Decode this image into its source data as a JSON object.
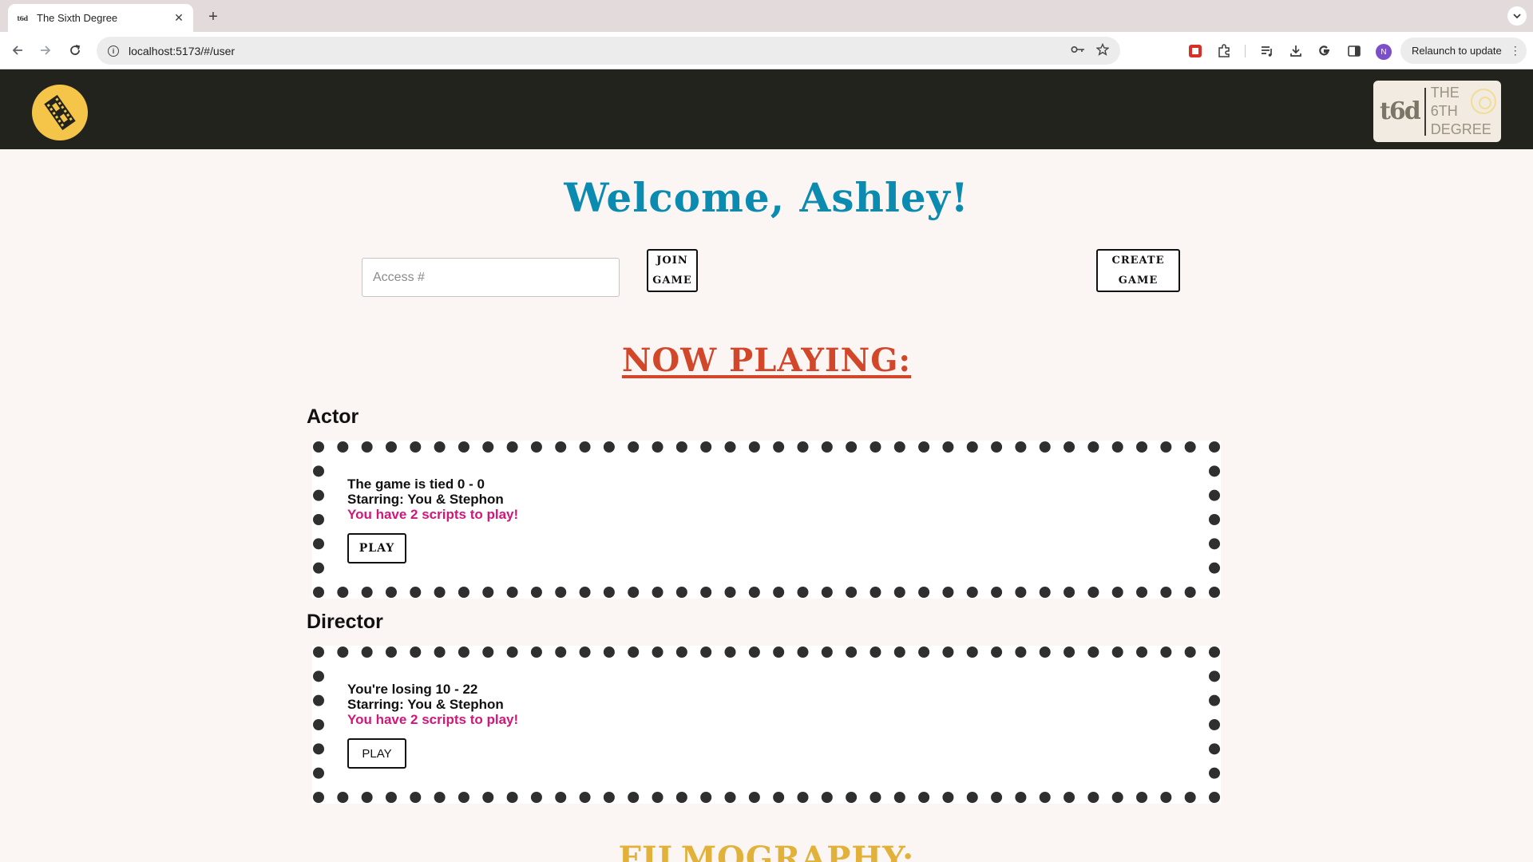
{
  "browser": {
    "tab": {
      "favicon_text": "t6d",
      "title": "The Sixth Degree",
      "close": "✕"
    },
    "new_tab": "+",
    "url": "localhost:5173/#/user",
    "relaunch_label": "Relaunch to update",
    "profile_initial": "N",
    "icons": [
      "back-arrow-icon",
      "forward-arrow-icon",
      "reload-icon",
      "site-info-icon",
      "password-key-icon",
      "bookmark-star-icon",
      "extension-icon",
      "puzzle-icon",
      "reading-list-icon",
      "download-icon",
      "google-icon",
      "side-panel-icon",
      "kebab-menu-icon"
    ]
  },
  "header": {
    "logo_icon": "film-reel-icon",
    "brand": {
      "monogram": "t6d",
      "line1": "THE",
      "line2": "6TH",
      "line3": "DEGREE"
    }
  },
  "main": {
    "welcome": "Welcome, Ashley!",
    "access_placeholder": "Access #",
    "join_line1": "JOIN",
    "join_line2": "GAME",
    "create_line1": "CREATE",
    "create_line2": "GAME",
    "now_playing": "NOW PLAYING:",
    "games": [
      {
        "role": "Actor",
        "status": "The game is tied 0 - 0",
        "starring": "Starring: You & Stephon",
        "scripts": "You have 2 scripts to play!",
        "play_label": "PLAY"
      },
      {
        "role": "Director",
        "status": "You're losing 10 - 22",
        "starring": "Starring: You & Stephon",
        "scripts": "You have 2 scripts to play!",
        "play_label": "PLAY"
      }
    ],
    "filmography": "FILMOGRAPHY:"
  },
  "colors": {
    "welcome": "#0b8bb0",
    "now_playing": "#d2472a",
    "filmography": "#e2b13a",
    "scripts": "#d0177a",
    "header_bg": "#23231e",
    "logo": "#f5c54a",
    "page_bg": "#fbf5f4"
  }
}
